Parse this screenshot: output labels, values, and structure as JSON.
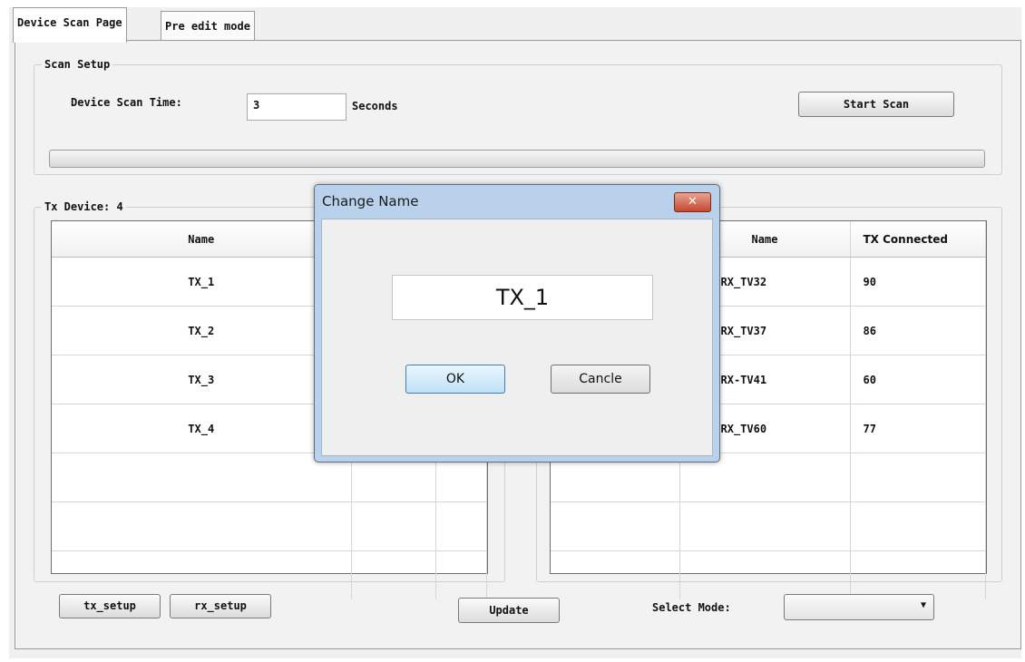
{
  "tabs": [
    {
      "label": "Device Scan Page",
      "active": true
    },
    {
      "label": "Pre edit mode",
      "active": false
    }
  ],
  "scan_setup": {
    "title": "Scan Setup",
    "scan_time_label": "Device Scan Time:",
    "scan_time_value": "3",
    "unit_label": "Seconds",
    "start_button": "Start Scan",
    "progress_value": 0
  },
  "tx": {
    "title": "Tx Device: 4",
    "header_name": "Name",
    "rows": [
      "TX_1",
      "TX_2",
      "TX_3",
      "TX_4"
    ]
  },
  "rx": {
    "header_name": "Name",
    "header_tx_connected": "TX Connected",
    "rows": [
      {
        "name": "RX_TV32",
        "tx": "90"
      },
      {
        "name": "RX_TV37",
        "tx": "86"
      },
      {
        "name": "RX-TV41",
        "tx": "60"
      },
      {
        "name": "RX_TV60",
        "tx": "77"
      }
    ]
  },
  "bottom": {
    "tx_setup": "tx_setup",
    "rx_setup": "rx_setup",
    "update": "Update",
    "select_mode_label": "Select Mode:",
    "select_mode_value": ""
  },
  "dialog": {
    "title": "Change Name",
    "close_glyph": "✕",
    "input_value": "TX_1",
    "ok": "OK",
    "cancel": "Cancle"
  }
}
